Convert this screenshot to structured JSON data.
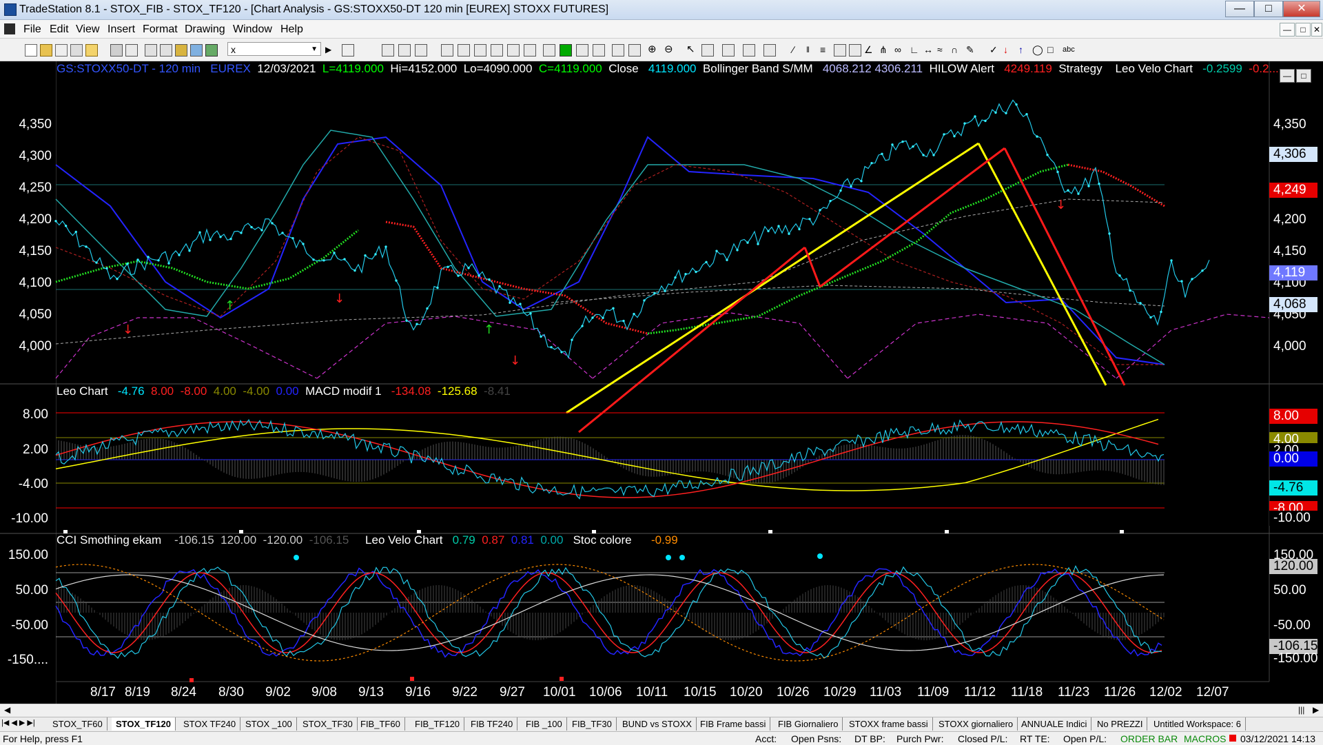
{
  "window": {
    "title": "TradeStation 8.1 - STOX_FIB - STOX_TF120 - [Chart Analysis - GS:STOXX50-DT  120 min  [EUREX] STOXX FUTURES]"
  },
  "menu": [
    "File",
    "Edit",
    "View",
    "Insert",
    "Format",
    "Drawing",
    "Window",
    "Help"
  ],
  "toolbar": {
    "symbol_box_value": "x"
  },
  "price_pane": {
    "symbol": "GS:STOXX50-DT - 120 min",
    "exchange": "EUREX",
    "date": "12/03/2021",
    "last": "L=4119.000",
    "high": "Hi=4152.000",
    "low": "Lo=4090.000",
    "close_c": "C=4119.000",
    "close_label": "Close",
    "close_value": "4119.000",
    "bollinger_label": "Bollinger Band S/MM",
    "bollinger_values": "4068.212  4306.211",
    "hilow_label": "HILOW Alert",
    "hilow_value": "4249.119",
    "strategy_label": "Strategy",
    "leovelo_label": "Leo Velo Chart",
    "leovelo_v1": "-0.2599",
    "leovelo_v2": "-0.2...",
    "y_ticks": [
      "4,350",
      "4,300",
      "4,250",
      "4,200",
      "4,150",
      "4,100",
      "4,050",
      "4,000"
    ],
    "price_tags": [
      {
        "text": "4,306",
        "bg": "#d4e6fb",
        "fg": "#000000"
      },
      {
        "text": "4,249",
        "bg": "#e60000",
        "fg": "#ffffff"
      },
      {
        "text": "4,119",
        "bg": "#6f78ff",
        "fg": "#ffffff"
      },
      {
        "text": "4,068",
        "bg": "#d4e6fb",
        "fg": "#000000"
      }
    ],
    "markers": [
      "-1",
      "1",
      "-1",
      "-1",
      "1",
      "-1",
      "1",
      "-1",
      "1",
      "-1"
    ]
  },
  "mid_pane": {
    "leo_label": "Leo Chart",
    "leo_values": [
      "-4.76",
      "8.00",
      "-8.00",
      "4.00",
      "-4.00",
      "0.00"
    ],
    "macd_label": "MACD modif 1",
    "macd_values": [
      "-134.08",
      "-125.68",
      "-8.41"
    ],
    "y_ticks": [
      "8.00",
      "2.00",
      "-4.00",
      "-10.00"
    ],
    "tags": [
      {
        "text": "8.00",
        "bg": "#e60000",
        "fg": "#ffffff"
      },
      {
        "text": "4.00",
        "bg": "#8a8a00",
        "fg": "#ffffff"
      },
      {
        "text": "2.00",
        "bg": "#000000",
        "fg": "#ffffff"
      },
      {
        "text": "0.00",
        "bg": "#0000e6",
        "fg": "#ffffff"
      },
      {
        "text": "-4.76",
        "bg": "#00e6e6",
        "fg": "#000000"
      },
      {
        "text": "-8.00",
        "bg": "#e60000",
        "fg": "#ffffff"
      },
      {
        "text": "-10.00",
        "bg": "#000000",
        "fg": "#ffffff"
      }
    ]
  },
  "low_pane": {
    "cci_label": "CCI Smothing ekam",
    "cci_values": [
      "-106.15",
      "120.00",
      "-120.00",
      "-106.15"
    ],
    "leovelo_label": "Leo Velo Chart",
    "leovelo_values": [
      "0.79",
      "0.87",
      "0.81",
      "0.00"
    ],
    "stoc_label": "Stoc colore",
    "stoc_value": "-0.99",
    "y_ticks": [
      "150.00",
      "50.00",
      "-50.00",
      "-150...."
    ],
    "right_ticks": [
      "150.00",
      "50.00",
      "-50.00",
      "-150.00"
    ],
    "tags": [
      {
        "text": "120.00",
        "bg": "#c8c8c8",
        "fg": "#000000"
      },
      {
        "text": "-106.15",
        "bg": "#c8c8c8",
        "fg": "#000000"
      }
    ]
  },
  "x_axis": [
    "8/17",
    "8/19",
    "8/24",
    "8/30",
    "9/02",
    "9/08",
    "9/13",
    "9/16",
    "9/22",
    "9/27",
    "10/01",
    "10/06",
    "10/11",
    "10/15",
    "10/20",
    "10/26",
    "10/29",
    "11/03",
    "11/09",
    "11/12",
    "11/18",
    "11/23",
    "11/26",
    "12/02",
    "12/07"
  ],
  "tabs": [
    "STOX_TF60",
    "STOX_TF120",
    "STOX TF240",
    "STOX _100",
    "STOX_TF30",
    "FIB_TF60",
    "FIB_TF120",
    "FIB TF240",
    "FIB _100",
    "FIB_TF30",
    "BUND vs STOXX",
    "FIB Frame bassi",
    "FIB Giornaliero",
    "STOXX frame bassi",
    "STOXX giornaliero",
    "ANNUALE Indici",
    "No PREZZI",
    "Untitled Workspace: 6"
  ],
  "active_tab": "STOX_TF120",
  "status": {
    "help": "For Help, press F1",
    "acct": "Acct:",
    "open_psns": "Open Psns:",
    "dt_bp": "DT BP:",
    "purch_pwr": "Purch Pwr:",
    "closed_pl": "Closed P/L:",
    "rt_te": "RT TE:",
    "open_pl": "Open P/L:",
    "order_bar": "ORDER BAR",
    "macros": "MACROS",
    "datetime": "03/12/2021 14:13"
  },
  "colors": {
    "bg": "#000000",
    "price": "#00e5ff",
    "up": "#00dd00",
    "down": "#ff2020",
    "trend_yellow": "#ffff00",
    "bollinger": "#2424ff",
    "magenta": "#cc33cc"
  }
}
